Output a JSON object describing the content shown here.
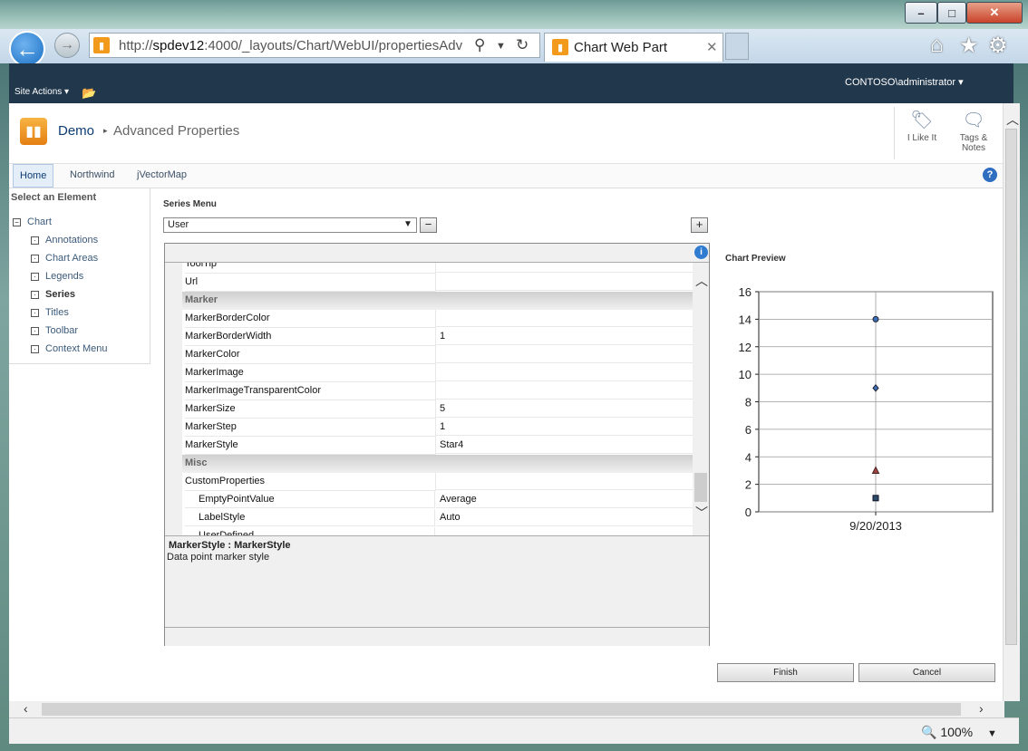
{
  "browser": {
    "address": {
      "prefix": "http://",
      "host": "spdev12",
      "rest": ":4000/_layouts/Chart/WebUI/propertiesAdv"
    },
    "tab_title": "Chart Web Part",
    "zoom": "100%"
  },
  "ribbon": {
    "site_actions": "Site Actions",
    "user": "CONTOSO\\administrator"
  },
  "title_area": {
    "site": "Demo",
    "page": "Advanced Properties",
    "social": [
      {
        "label": "I Like It"
      },
      {
        "label": "Tags &",
        "label2": "Notes"
      }
    ]
  },
  "topnav": [
    "Home",
    "Northwind",
    "jVectorMap"
  ],
  "tree": {
    "title": "Select an Element",
    "root": "Chart",
    "children": [
      "Annotations",
      "Chart Areas",
      "Legends",
      "Series",
      "Titles",
      "Toolbar",
      "Context Menu"
    ],
    "selected": "Series"
  },
  "series_menu": {
    "label": "Series Menu",
    "selected": "User",
    "remove_symbol": "−",
    "add_symbol": "+"
  },
  "property_grid": {
    "rows": [
      {
        "name": "ToolTip",
        "value": ""
      },
      {
        "name": "Url",
        "value": ""
      },
      {
        "name": "Marker",
        "category": true
      },
      {
        "name": "MarkerBorderColor",
        "value": ""
      },
      {
        "name": "MarkerBorderWidth",
        "value": "1"
      },
      {
        "name": "MarkerColor",
        "value": ""
      },
      {
        "name": "MarkerImage",
        "value": ""
      },
      {
        "name": "MarkerImageTransparentColor",
        "value": ""
      },
      {
        "name": "MarkerSize",
        "value": "5"
      },
      {
        "name": "MarkerStep",
        "value": "1"
      },
      {
        "name": "MarkerStyle",
        "value": "Star4"
      },
      {
        "name": "Misc",
        "category": true
      },
      {
        "name": "CustomProperties",
        "value": ""
      },
      {
        "name": "EmptyPointValue",
        "value": "Average",
        "sub": true
      },
      {
        "name": "LabelStyle",
        "value": "Auto",
        "sub": true
      },
      {
        "name": "UserDefined",
        "value": "",
        "sub": true
      }
    ],
    "description_title": "MarkerStyle : MarkerStyle",
    "description_text": "Data point marker style"
  },
  "preview": {
    "label": "Chart Preview"
  },
  "chart_data": {
    "type": "scatter",
    "title": "",
    "xlabel": "",
    "ylabel": "",
    "categories": [
      "9/20/2013"
    ],
    "ylim": [
      0,
      16
    ],
    "yticks": [
      0,
      2,
      4,
      6,
      8,
      10,
      12,
      14,
      16
    ],
    "grid": true,
    "series": [
      {
        "values": [
          14
        ],
        "color": "#3a6fb5",
        "marker": "circle"
      },
      {
        "values": [
          9
        ],
        "color": "#3a6fb5",
        "marker": "diamond"
      },
      {
        "values": [
          3
        ],
        "color": "#a04040",
        "marker": "triangle"
      },
      {
        "values": [
          1
        ],
        "color": "#2a4a6a",
        "marker": "square"
      }
    ]
  },
  "buttons": {
    "finish": "Finish",
    "cancel": "Cancel"
  }
}
